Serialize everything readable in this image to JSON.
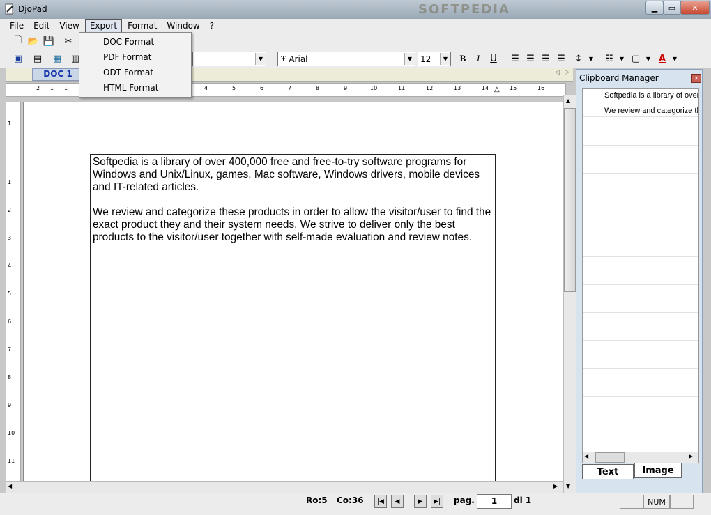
{
  "window": {
    "title": "DjoPad",
    "watermark": "SOFTPEDIA"
  },
  "menubar": [
    "File",
    "Edit",
    "View",
    "Export",
    "Format",
    "Window",
    "?"
  ],
  "export_menu": [
    "DOC Format",
    "PDF Format",
    "ODT Format",
    "HTML Format"
  ],
  "toolbar": {
    "font_name": "Arial",
    "font_size": "12"
  },
  "tabs": {
    "doc": "DOC 1"
  },
  "ruler_numbers": [
    "2",
    "1",
    "1",
    "4",
    "5",
    "6",
    "7",
    "8",
    "9",
    "10",
    "11",
    "12",
    "13",
    "14",
    "15",
    "16"
  ],
  "vruler_numbers": [
    "1",
    "1",
    "2",
    "3",
    "4",
    "5",
    "6",
    "7",
    "8",
    "9",
    "10",
    "11"
  ],
  "document": {
    "paragraphs": [
      "Softpedia is a library of over 400,000 free and free-to-try software programs for Windows and Unix/Linux, games, Mac software, Windows drivers, mobile devices and IT-related articles.",
      "We review and categorize these products in order to allow the visitor/user to find the exact product they and their system needs. We strive to deliver only the best products to the visitor/user together with self-made evaluation and review notes."
    ]
  },
  "clipboard": {
    "title": "Clipboard Manager",
    "items": [
      "Softpedia is a library of over",
      "We review and categorize th"
    ],
    "tabs": [
      "Text",
      "Image"
    ]
  },
  "status": {
    "row": "Ro:5",
    "col": "Co:36",
    "page_label": "pag.",
    "page": "1",
    "total": "di 1",
    "num": "NUM"
  }
}
